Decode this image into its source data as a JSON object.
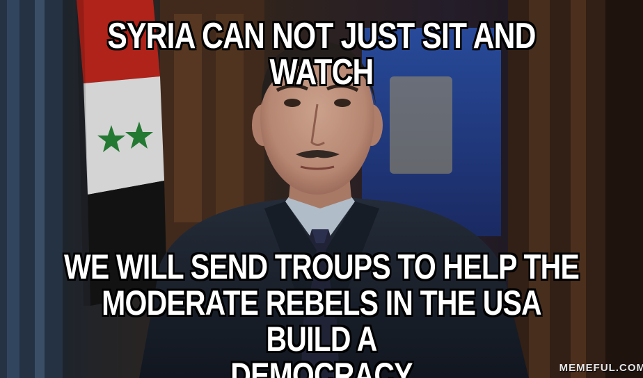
{
  "meme": {
    "top_text": "SYRIA CAN NOT JUST SIT AND WATCH",
    "bottom_lines": [
      "WE WILL SEND TROUPS TO HELP THE",
      "MODERATE REBELS IN THE USA BUILD A",
      "DEMOCRACY"
    ],
    "watermark": "MEMEFUL.COM"
  },
  "colors": {
    "caption_fill": "#ffffff",
    "caption_outline": "#000000",
    "flag_red": "#c8281e",
    "flag_white": "#f2f2f2",
    "flag_green_star": "#2a8a3a",
    "suit": "#1c2430",
    "shirt": "#c9d6e4",
    "tie": "#25283e",
    "blue_panel": "#2a4a9a"
  },
  "icons": {
    "flag": "syrian-flag",
    "person": "speaker-portrait"
  }
}
